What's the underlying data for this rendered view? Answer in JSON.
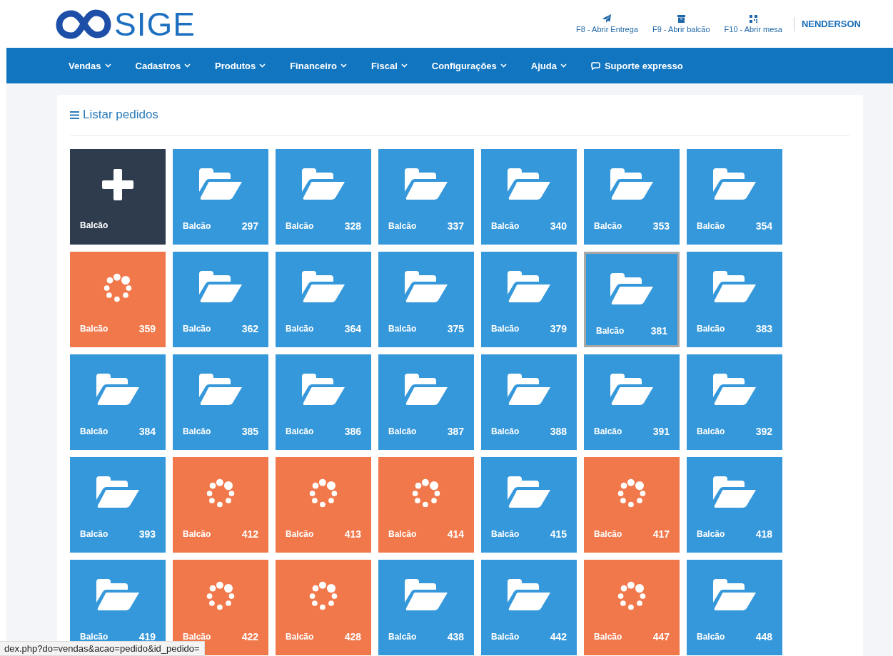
{
  "header": {
    "logo_text": "SIGE",
    "shortcuts": [
      {
        "kind": "delivery",
        "label": "F8 - Abrir Entrega"
      },
      {
        "kind": "counter",
        "label": "F9 - Abrir balcão"
      },
      {
        "kind": "table",
        "label": "F10 - Abrir mesa"
      }
    ],
    "user": "NENDERSON"
  },
  "nav": [
    {
      "label": "Vendas",
      "kind": "menu"
    },
    {
      "label": "Cadastros",
      "kind": "menu"
    },
    {
      "label": "Produtos",
      "kind": "menu"
    },
    {
      "label": "Financeiro",
      "kind": "menu"
    },
    {
      "label": "Fiscal",
      "kind": "menu"
    },
    {
      "label": "Configurações",
      "kind": "menu"
    },
    {
      "label": "Ajuda",
      "kind": "menu"
    },
    {
      "label": "Suporte expresso",
      "kind": "support"
    }
  ],
  "panel": {
    "title": "Listar pedidos"
  },
  "orders": [
    {
      "kind": "new",
      "label": "Balcão",
      "selected": false
    },
    {
      "kind": "open",
      "label": "Balcão",
      "number": "297",
      "selected": false
    },
    {
      "kind": "open",
      "label": "Balcão",
      "number": "328",
      "selected": false
    },
    {
      "kind": "open",
      "label": "Balcão",
      "number": "337",
      "selected": false
    },
    {
      "kind": "open",
      "label": "Balcão",
      "number": "340",
      "selected": false
    },
    {
      "kind": "open",
      "label": "Balcão",
      "number": "353",
      "selected": false
    },
    {
      "kind": "open",
      "label": "Balcão",
      "number": "354",
      "selected": false
    },
    {
      "kind": "pending",
      "label": "Balcão",
      "number": "359",
      "selected": false
    },
    {
      "kind": "open",
      "label": "Balcão",
      "number": "362",
      "selected": false
    },
    {
      "kind": "open",
      "label": "Balcão",
      "number": "364",
      "selected": false
    },
    {
      "kind": "open",
      "label": "Balcão",
      "number": "375",
      "selected": false
    },
    {
      "kind": "open",
      "label": "Balcão",
      "number": "379",
      "selected": false
    },
    {
      "kind": "open",
      "label": "Balcão",
      "number": "381",
      "selected": true
    },
    {
      "kind": "open",
      "label": "Balcão",
      "number": "383",
      "selected": false
    },
    {
      "kind": "open",
      "label": "Balcão",
      "number": "384",
      "selected": false
    },
    {
      "kind": "open",
      "label": "Balcão",
      "number": "385",
      "selected": false
    },
    {
      "kind": "open",
      "label": "Balcão",
      "number": "386",
      "selected": false
    },
    {
      "kind": "open",
      "label": "Balcão",
      "number": "387",
      "selected": false
    },
    {
      "kind": "open",
      "label": "Balcão",
      "number": "388",
      "selected": false
    },
    {
      "kind": "open",
      "label": "Balcão",
      "number": "391",
      "selected": false
    },
    {
      "kind": "open",
      "label": "Balcão",
      "number": "392",
      "selected": false
    },
    {
      "kind": "open",
      "label": "Balcão",
      "number": "393",
      "selected": false
    },
    {
      "kind": "pending",
      "label": "Balcão",
      "number": "412",
      "selected": false
    },
    {
      "kind": "pending",
      "label": "Balcão",
      "number": "413",
      "selected": false
    },
    {
      "kind": "pending",
      "label": "Balcão",
      "number": "414",
      "selected": false
    },
    {
      "kind": "open",
      "label": "Balcão",
      "number": "415",
      "selected": false
    },
    {
      "kind": "pending",
      "label": "Balcão",
      "number": "417",
      "selected": false
    },
    {
      "kind": "open",
      "label": "Balcão",
      "number": "418",
      "selected": false
    },
    {
      "kind": "open",
      "label": "Balcão",
      "number": "419",
      "selected": false
    },
    {
      "kind": "pending",
      "label": "Balcão",
      "number": "422",
      "selected": false
    },
    {
      "kind": "pending",
      "label": "Balcão",
      "number": "428",
      "selected": false
    },
    {
      "kind": "open",
      "label": "Balcão",
      "number": "438",
      "selected": false
    },
    {
      "kind": "open",
      "label": "Balcão",
      "number": "442",
      "selected": false
    },
    {
      "kind": "pending",
      "label": "Balcão",
      "number": "447",
      "selected": false
    },
    {
      "kind": "open",
      "label": "Balcão",
      "number": "448",
      "selected": false
    }
  ],
  "status_bar": {
    "url": "dex.php?do=vendas&acao=pedido&id_pedido="
  }
}
